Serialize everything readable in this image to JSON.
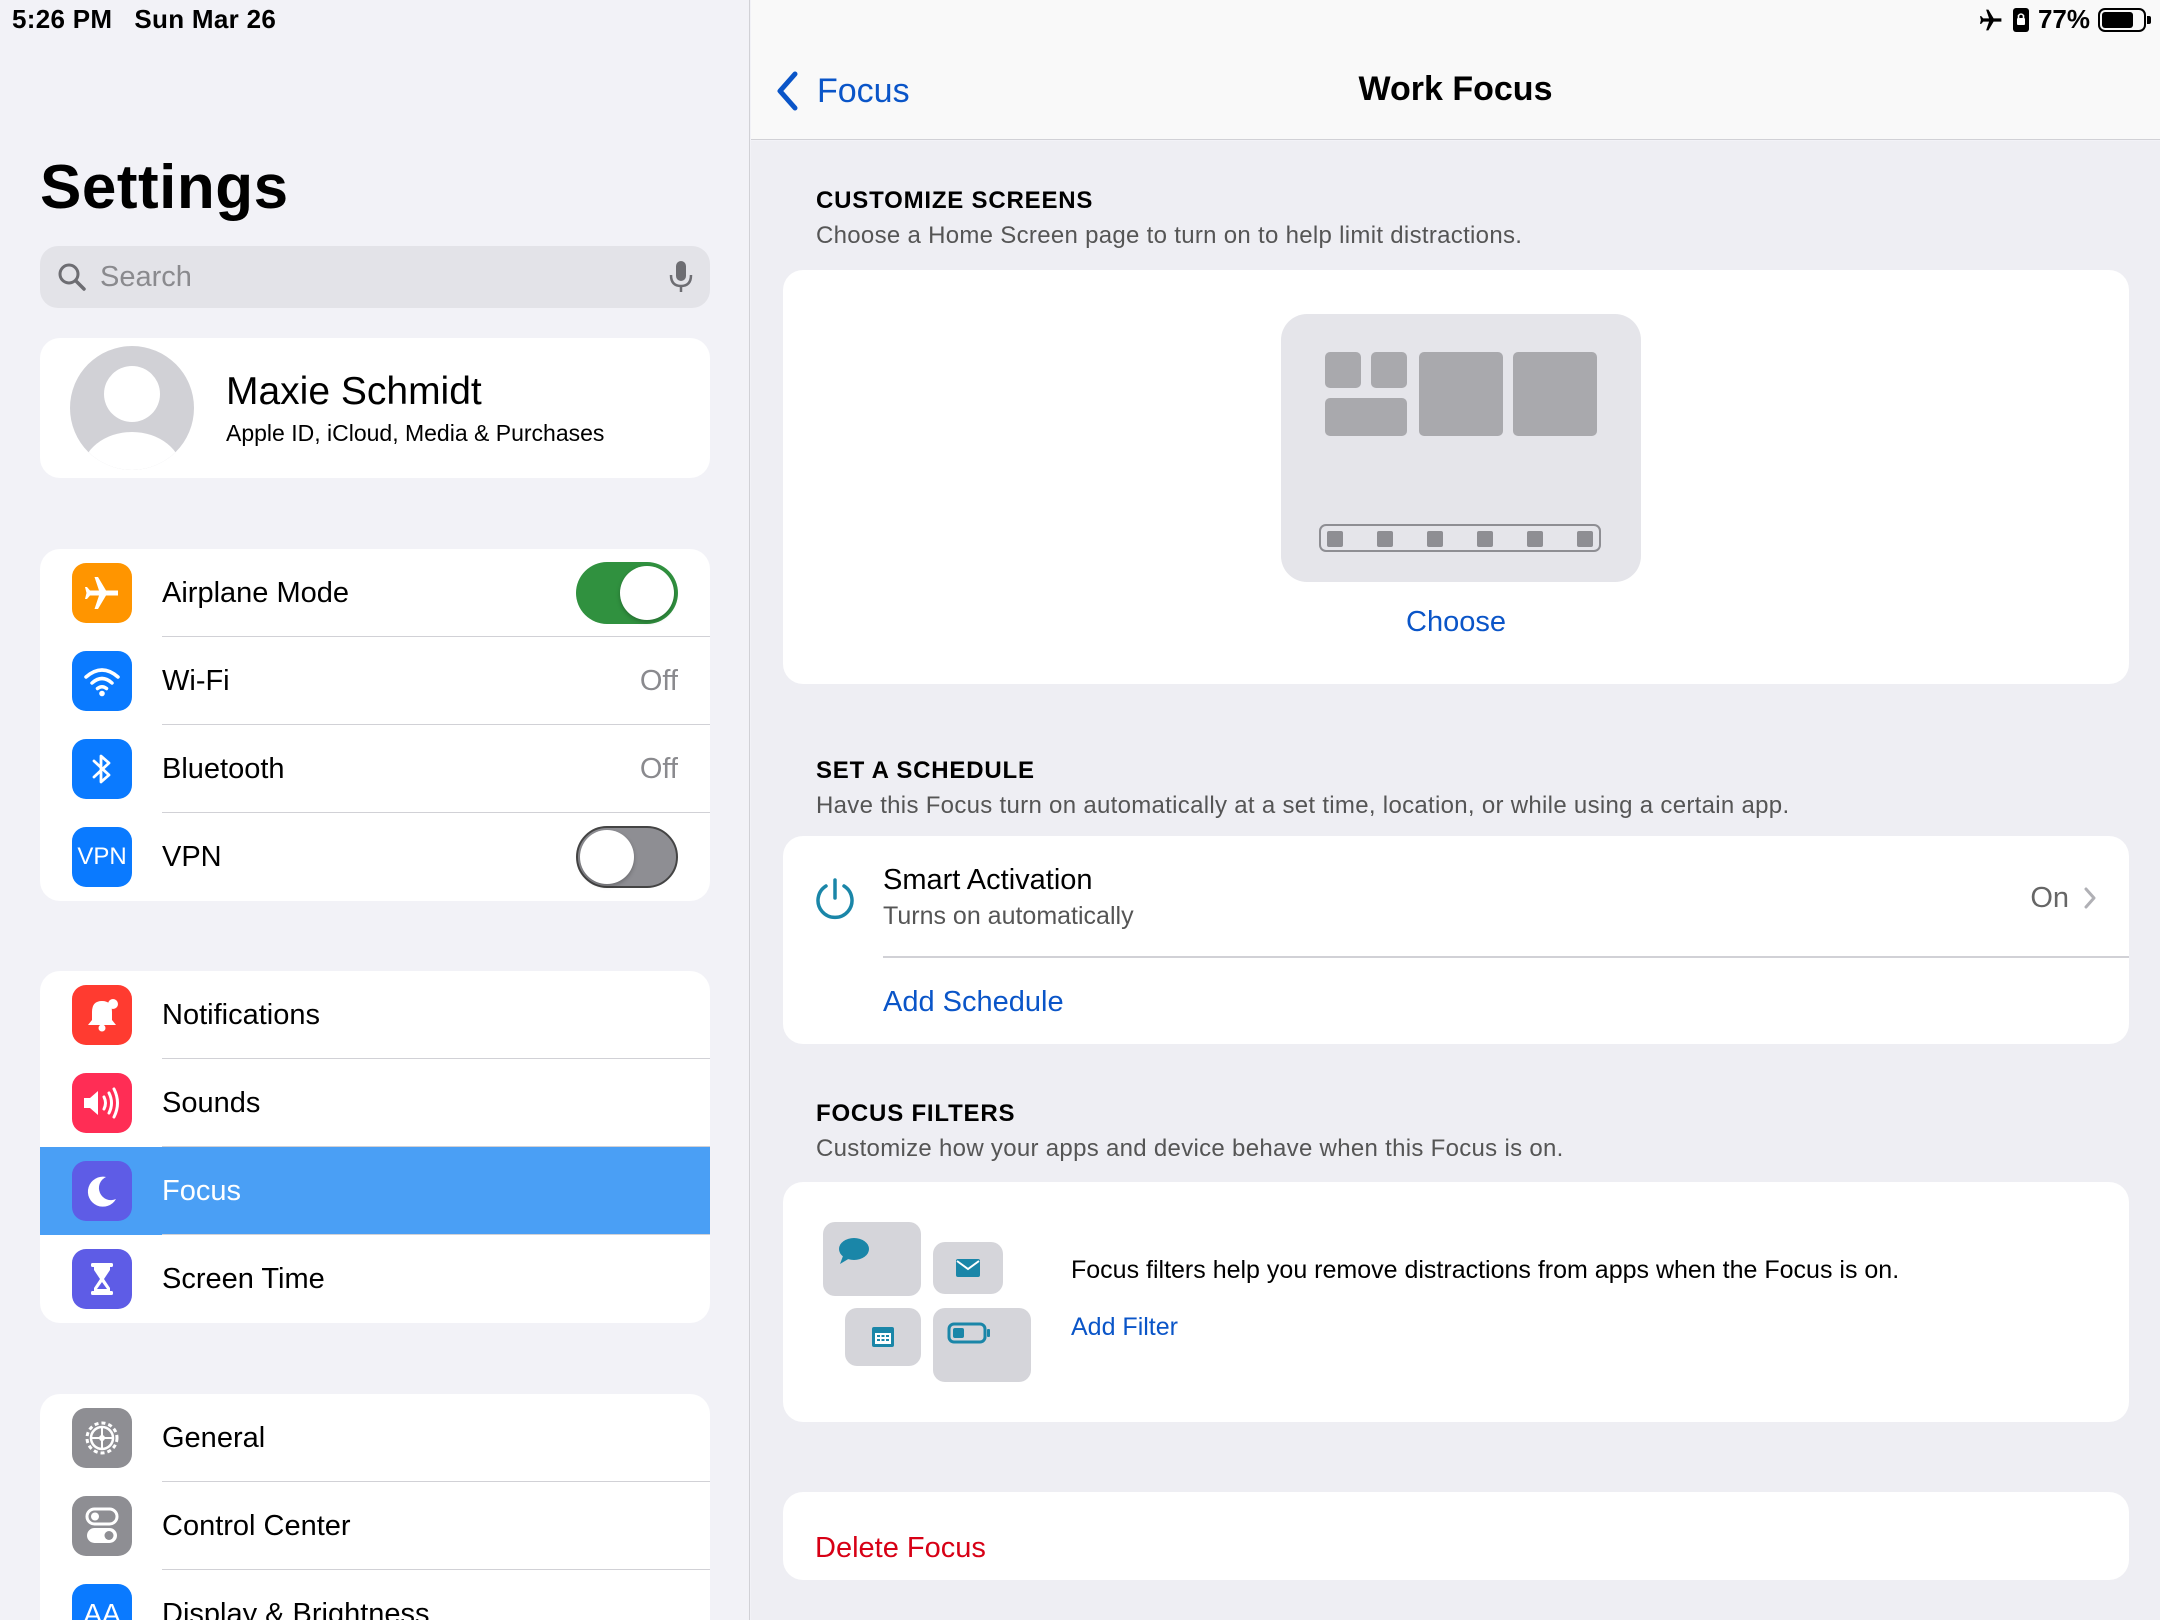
{
  "status": {
    "time": "5:26 PM",
    "date": "Sun Mar 26",
    "battery": "77%",
    "battery_level": 0.77
  },
  "sidebar": {
    "title": "Settings",
    "search_placeholder": "Search",
    "profile": {
      "name": "Maxie Schmidt",
      "subtitle": "Apple ID, iCloud, Media & Purchases"
    },
    "group1": [
      {
        "label": "Airplane Mode",
        "icon": "airplane-icon",
        "color": "#ff9500",
        "toggle": true
      },
      {
        "label": "Wi-Fi",
        "icon": "wifi-icon",
        "color": "#0a7aff",
        "value": "Off"
      },
      {
        "label": "Bluetooth",
        "icon": "bluetooth-icon",
        "color": "#0a7aff",
        "value": "Off"
      },
      {
        "label": "VPN",
        "icon": "vpn-icon",
        "color": "#0a7aff",
        "icon_text": "VPN",
        "toggle": false
      }
    ],
    "group2": [
      {
        "label": "Notifications",
        "icon": "bell-icon",
        "color": "#ff3b30"
      },
      {
        "label": "Sounds",
        "icon": "speaker-icon",
        "color": "#ff2d55"
      },
      {
        "label": "Focus",
        "icon": "moon-icon",
        "color": "#5e5ce6",
        "selected": true
      },
      {
        "label": "Screen Time",
        "icon": "hourglass-icon",
        "color": "#5e5ce6"
      }
    ],
    "group3": [
      {
        "label": "General",
        "icon": "gear-icon",
        "color": "#8e8e93"
      },
      {
        "label": "Control Center",
        "icon": "switches-icon",
        "color": "#8e8e93"
      },
      {
        "label": "Display & Brightness",
        "icon": "text-size-icon",
        "color": "#0a7aff",
        "icon_text": "AA"
      }
    ]
  },
  "detail": {
    "back_label": "Focus",
    "title": "Work Focus",
    "customize": {
      "header": "CUSTOMIZE SCREENS",
      "subtitle": "Choose a Home Screen page to turn on to help limit distractions.",
      "choose_label": "Choose"
    },
    "schedule": {
      "header": "SET A SCHEDULE",
      "subtitle": "Have this Focus turn on automatically at a set time, location, or while using a certain app.",
      "smart_title": "Smart Activation",
      "smart_sub": "Turns on automatically",
      "smart_value": "On",
      "add_label": "Add Schedule"
    },
    "filters": {
      "header": "FOCUS FILTERS",
      "subtitle": "Customize how your apps and device behave when this Focus is on.",
      "description": "Focus filters help you remove distractions from apps when the Focus is on.",
      "add_label": "Add Filter"
    },
    "delete_label": "Delete Focus"
  },
  "colors": {
    "accent": "#0a55c8",
    "destructive": "#d70015",
    "selected_row": "#4a9ff5",
    "toggle_on": "#30913f"
  }
}
